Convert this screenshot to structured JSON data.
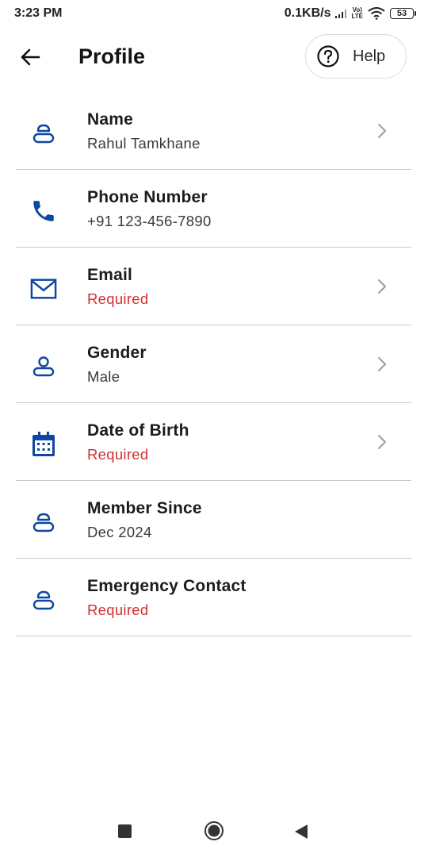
{
  "status_bar": {
    "time": "3:23 PM",
    "network_speed": "0.1KB/s",
    "volte_top": "Vo)",
    "volte_bottom": "LTE",
    "battery": "53"
  },
  "header": {
    "back_icon": "arrow-left-icon",
    "title": "Profile",
    "help_label": "Help",
    "help_icon": "question-circle-icon"
  },
  "profile_fields": [
    {
      "label": "Name",
      "value": "Rahul Tamkhane",
      "required": false,
      "icon": "person-icon",
      "has_chevron": true
    },
    {
      "label": "Phone Number",
      "value": "+91 123-456-7890",
      "required": false,
      "icon": "phone-icon",
      "has_chevron": false
    },
    {
      "label": "Email",
      "value": "Required",
      "required": true,
      "icon": "mail-icon",
      "has_chevron": true
    },
    {
      "label": "Gender",
      "value": "Male",
      "required": false,
      "icon": "person-icon",
      "has_chevron": true
    },
    {
      "label": "Date of Birth",
      "value": "Required",
      "required": true,
      "icon": "calendar-icon",
      "has_chevron": true
    },
    {
      "label": "Member Since",
      "value": "Dec 2024",
      "required": false,
      "icon": "person-icon",
      "has_chevron": false
    },
    {
      "label": "Emergency Contact",
      "value": "Required",
      "required": true,
      "icon": "person-icon",
      "has_chevron": false
    }
  ],
  "colors": {
    "icon_blue": "#0d47a1",
    "required_red": "#d32f2f",
    "divider": "#c9c9c9"
  },
  "nav_bar": {
    "recents_icon": "square-icon",
    "home_icon": "circle-home-icon",
    "back_icon": "triangle-back-icon"
  }
}
